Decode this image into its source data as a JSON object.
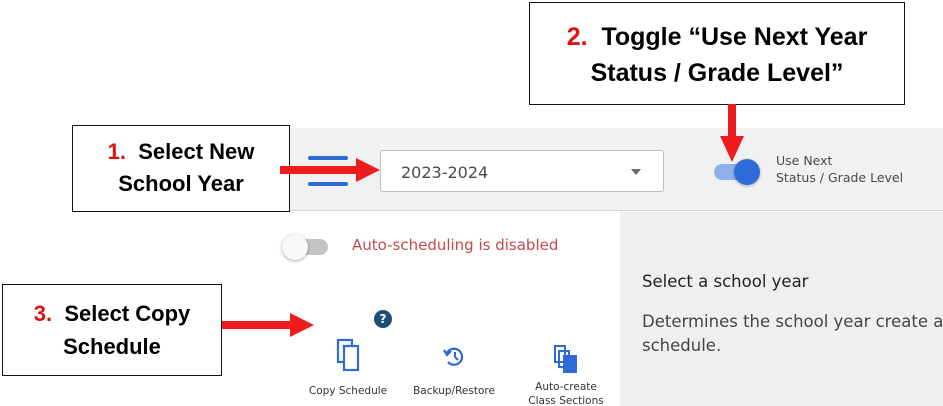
{
  "callouts": {
    "c1": {
      "number": "1.",
      "line1": "Select New",
      "line2": "School Year"
    },
    "c2": {
      "number": "2.",
      "line1": "Toggle “Use Next Year",
      "line2": "Status / Grade Level”"
    },
    "c3": {
      "number": "3.",
      "line1": "Select Copy",
      "line2": "Schedule"
    }
  },
  "colors": {
    "accent": "#2e6bd8",
    "callout_number": "#e01010",
    "arrow": "#ee1c1c",
    "warning_text": "#c44a4a"
  },
  "topbar": {
    "menu_icon": "hamburger-menu-icon",
    "year_select": {
      "value": "2023-2024",
      "icon": "caret-down-icon"
    },
    "next_year_toggle": {
      "state": "on",
      "line1": "Use Next",
      "line2": "Status / Grade Level"
    }
  },
  "left_panel": {
    "auto_scheduling": {
      "state": "off",
      "text": "Auto-scheduling is disabled"
    },
    "tools": [
      {
        "label": "Copy Schedule",
        "icon": "copy-icon"
      },
      {
        "label": "Backup/Restore",
        "icon": "history-icon"
      },
      {
        "label_line1": "Auto-create",
        "label_line2": "Class Sections",
        "icon": "copy-filled-icon"
      }
    ],
    "help_badge": "?"
  },
  "right_panel": {
    "title": "Select a school year",
    "description": "Determines the school year create a schedule."
  }
}
